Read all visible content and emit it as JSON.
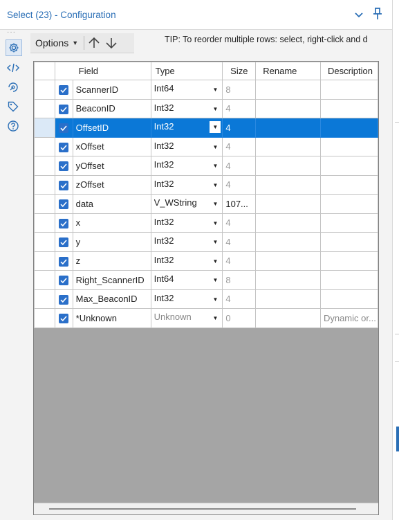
{
  "window": {
    "title": "Select (23) - Configuration"
  },
  "sidebar": {
    "items": [
      {
        "icon": "gear-icon",
        "active": true
      },
      {
        "icon": "code-icon",
        "active": false
      },
      {
        "icon": "radar-icon",
        "active": false
      },
      {
        "icon": "tag-icon",
        "active": false
      },
      {
        "icon": "help-icon",
        "active": false
      }
    ]
  },
  "toolbar": {
    "options_label": "Options",
    "tip": "TIP: To reorder multiple rows: select, right-click and d"
  },
  "table": {
    "columns": [
      "Field",
      "Type",
      "Size",
      "Rename",
      "Description"
    ],
    "rows": [
      {
        "checked": true,
        "field": "ScannerID",
        "type": "Int64",
        "size": "8",
        "rename": "",
        "description": "",
        "selected": false
      },
      {
        "checked": true,
        "field": "BeaconID",
        "type": "Int32",
        "size": "4",
        "rename": "",
        "description": "",
        "selected": false
      },
      {
        "checked": true,
        "field": "OffsetID",
        "type": "Int32",
        "size": "4",
        "rename": "",
        "description": "",
        "selected": true
      },
      {
        "checked": true,
        "field": "xOffset",
        "type": "Int32",
        "size": "4",
        "rename": "",
        "description": "",
        "selected": false
      },
      {
        "checked": true,
        "field": "yOffset",
        "type": "Int32",
        "size": "4",
        "rename": "",
        "description": "",
        "selected": false
      },
      {
        "checked": true,
        "field": "zOffset",
        "type": "Int32",
        "size": "4",
        "rename": "",
        "description": "",
        "selected": false
      },
      {
        "checked": true,
        "field": "data",
        "type": "V_WString",
        "size": "107...",
        "rename": "",
        "description": "",
        "selected": false
      },
      {
        "checked": true,
        "field": "x",
        "type": "Int32",
        "size": "4",
        "rename": "",
        "description": "",
        "selected": false
      },
      {
        "checked": true,
        "field": "y",
        "type": "Int32",
        "size": "4",
        "rename": "",
        "description": "",
        "selected": false
      },
      {
        "checked": true,
        "field": "z",
        "type": "Int32",
        "size": "4",
        "rename": "",
        "description": "",
        "selected": false
      },
      {
        "checked": true,
        "field": "Right_ScannerID",
        "type": "Int64",
        "size": "8",
        "rename": "",
        "description": "",
        "selected": false
      },
      {
        "checked": true,
        "field": "Max_BeaconID",
        "type": "Int32",
        "size": "4",
        "rename": "",
        "description": "",
        "selected": false
      },
      {
        "checked": true,
        "field": "*Unknown",
        "type": "Unknown",
        "size": "0",
        "rename": "",
        "description": "Dynamic or...",
        "selected": false
      }
    ]
  },
  "colors": {
    "accent": "#0b78d7",
    "checkbox": "#2a6fc9",
    "title": "#2b6fb6"
  }
}
